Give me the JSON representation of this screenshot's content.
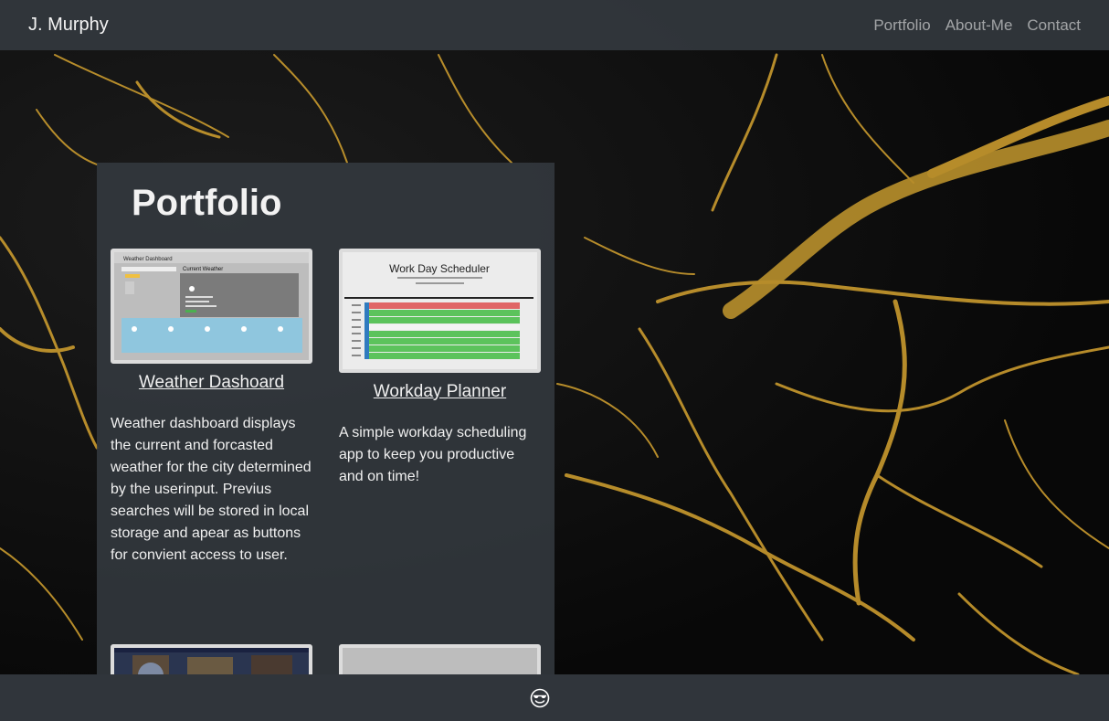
{
  "navbar": {
    "brand": "J. Murphy",
    "links": [
      "Portfolio",
      "About-Me",
      "Contact"
    ]
  },
  "portfolio": {
    "heading": "Portfolio",
    "projects": [
      {
        "title": "Weather Dashoard",
        "description": "Weather dashboard displays the current and forcasted weather for the city determined by the userinput. Previus searches will be stored in local storage and apear as buttons for convient access to user.",
        "thumb_header": "Weather Dashboard",
        "thumb_subheader": "Current Weather"
      },
      {
        "title": "Workday Planner",
        "description": "A simple workday scheduling app to keep you productive and on time!",
        "thumb_header": "Work Day Scheduler"
      }
    ]
  },
  "footer": {
    "icon": "sunglasses-smiley-icon"
  },
  "colors": {
    "navbar_bg": "#343a40",
    "gold_vein": "#d4a62a",
    "planner_red": "#e06666",
    "planner_green": "#5cc35c"
  }
}
